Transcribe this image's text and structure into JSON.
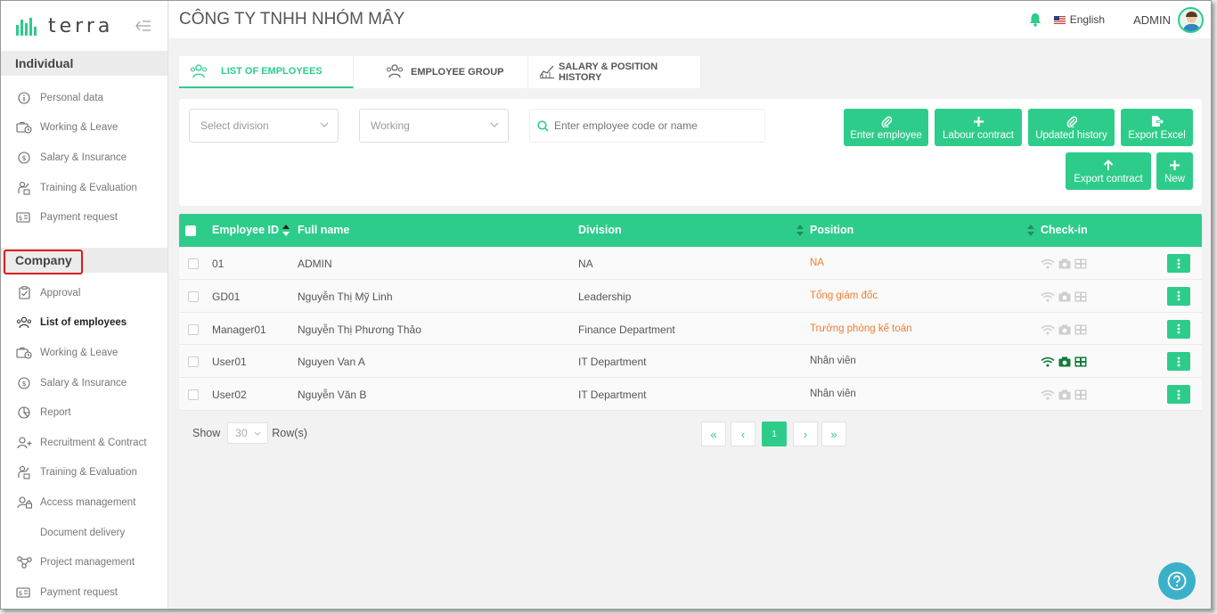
{
  "app": {
    "logo_text": "terra"
  },
  "sidebar": {
    "individual_label": "Individual",
    "individual_items": [
      {
        "label": "Personal data",
        "icon": "info-icon"
      },
      {
        "label": "Working & Leave",
        "icon": "briefcase-clock-icon"
      },
      {
        "label": "Salary & Insurance",
        "icon": "dollar-icon"
      },
      {
        "label": "Training & Evaluation",
        "icon": "training-icon"
      },
      {
        "label": "Payment request",
        "icon": "payment-icon"
      }
    ],
    "company_label": "Company",
    "company_items": [
      {
        "label": "Approval",
        "icon": "clipboard-check-icon"
      },
      {
        "label": "List of employees",
        "icon": "people-icon",
        "active": true
      },
      {
        "label": "Working & Leave",
        "icon": "briefcase-clock-icon"
      },
      {
        "label": "Salary & Insurance",
        "icon": "dollar-icon"
      },
      {
        "label": "Report",
        "icon": "pie-chart-icon"
      },
      {
        "label": "Recruitment & Contract",
        "icon": "user-plus-icon"
      },
      {
        "label": "Training & Evaluation",
        "icon": "training-icon"
      },
      {
        "label": "Access management",
        "icon": "user-lock-icon"
      },
      {
        "label": "Document delivery",
        "icon": ""
      },
      {
        "label": "Project management",
        "icon": "nodes-icon"
      },
      {
        "label": "Payment request",
        "icon": "payment-icon"
      }
    ]
  },
  "header": {
    "company_name": "CÔNG TY TNHH NHÓM MÂY",
    "language": "English",
    "user": "ADMIN"
  },
  "tabs": [
    {
      "label": "LIST OF EMPLOYEES",
      "active": true
    },
    {
      "label": "EMPLOYEE GROUP",
      "active": false
    },
    {
      "label": "SALARY & POSITION HISTORY",
      "active": false
    }
  ],
  "filters": {
    "division_placeholder": "Select division",
    "status_value": "Working",
    "search_placeholder": "Enter employee code or name"
  },
  "actions": {
    "enter_employee": "Enter employee",
    "labour_contract": "Labour contract",
    "updated_history": "Updated history",
    "export_excel": "Export Excel",
    "export_contract": "Export contract",
    "new": "New"
  },
  "table": {
    "columns": {
      "employee_id": "Employee ID",
      "full_name": "Full name",
      "division": "Division",
      "position": "Position",
      "check_in": "Check-in"
    },
    "rows": [
      {
        "id": "01",
        "name": "ADMIN",
        "division": "NA",
        "position": "NA",
        "position_highlight": true,
        "checkin_active": false
      },
      {
        "id": "GD01",
        "name": "Nguyễn Thị Mỹ Linh",
        "division": "Leadership",
        "position": "Tổng giám đốc",
        "position_highlight": true,
        "checkin_active": false
      },
      {
        "id": "Manager01",
        "name": "Nguyễn Thị Phương Thảo",
        "division": "Finance Department",
        "position": "Trưởng phòng kế toán",
        "position_highlight": true,
        "checkin_active": false
      },
      {
        "id": "User01",
        "name": "Nguyen Van A",
        "division": "IT Department",
        "position": "Nhân viên",
        "position_highlight": false,
        "checkin_active": true
      },
      {
        "id": "User02",
        "name": "Nguyễn Văn B",
        "division": "IT Department",
        "position": "Nhân viên",
        "position_highlight": false,
        "checkin_active": false
      }
    ]
  },
  "pagination": {
    "show_label": "Show",
    "rows_per_page": "30",
    "rows_label": "Row(s)",
    "first": "«",
    "prev": "‹",
    "current_page": "1",
    "next": "›",
    "last": "»"
  },
  "colors": {
    "accent": "#2ecc8a",
    "orange": "#f07e2f",
    "help": "#3bb0c9",
    "highlight_box": "#e0181c"
  }
}
